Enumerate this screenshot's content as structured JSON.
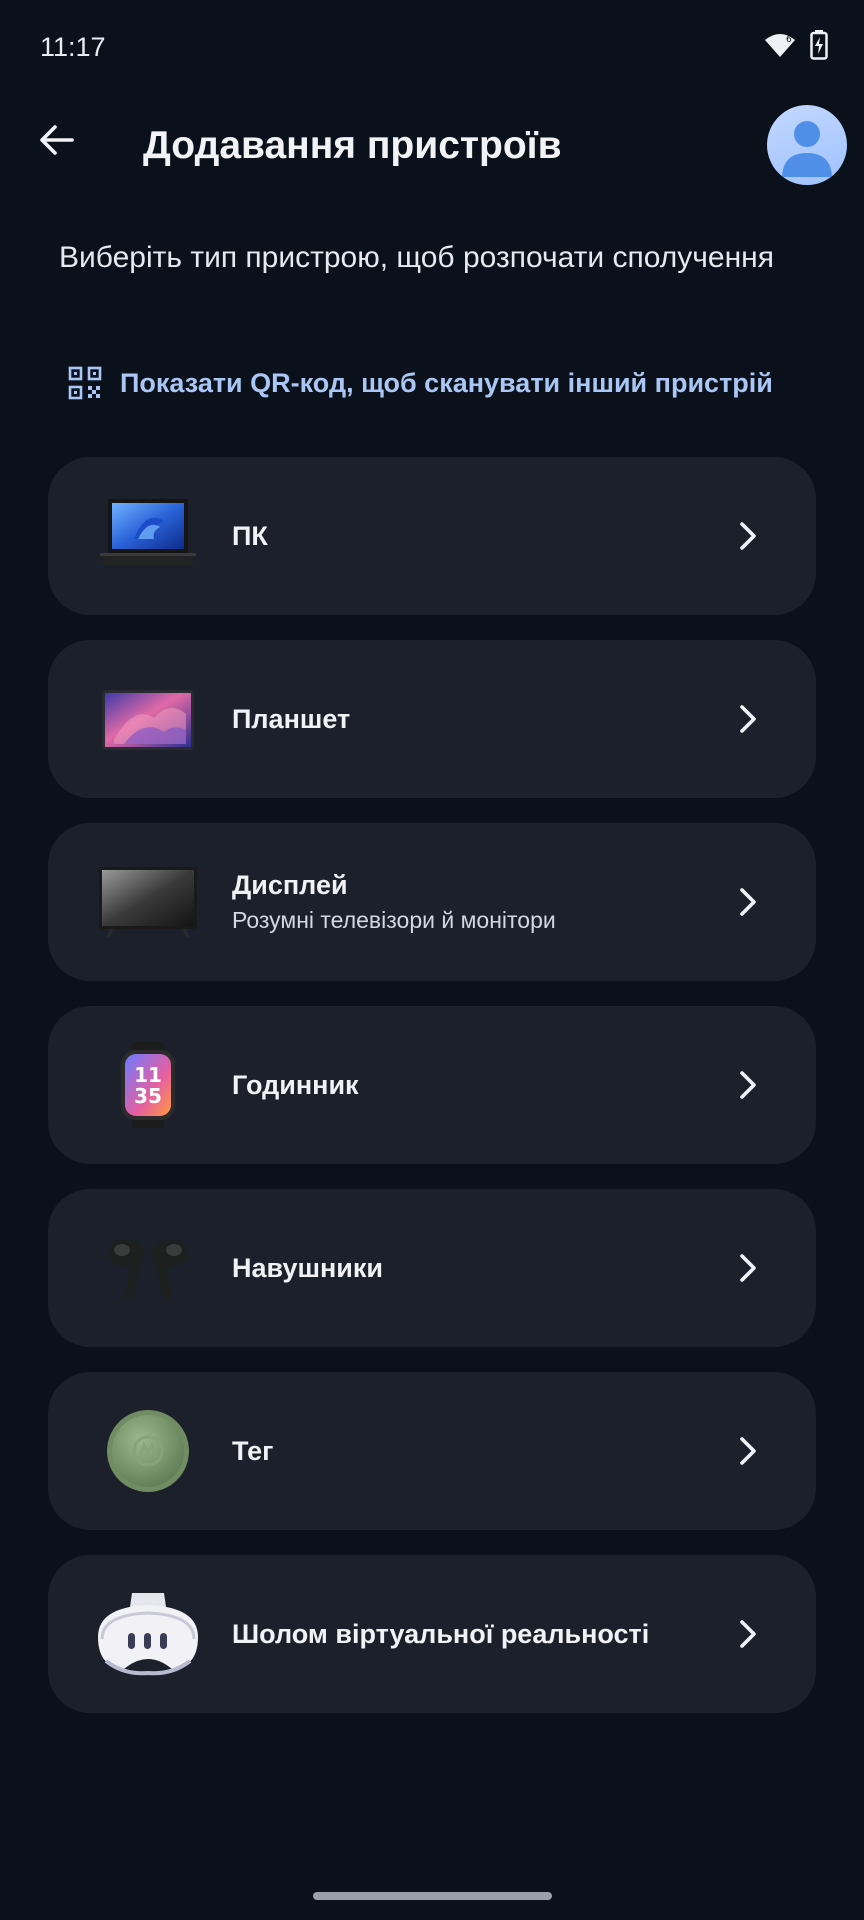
{
  "status_bar": {
    "time": "11:17",
    "wifi_icon": "wifi-icon",
    "battery_icon": "battery-charging-icon"
  },
  "header": {
    "title": "Додавання пристроїв",
    "back_icon": "arrow-left-icon",
    "avatar_icon": "account-avatar-icon"
  },
  "intro": "Виберіть тип пристрою, щоб розпочати сполучення",
  "qr_link": {
    "label": "Показати QR-код, щоб сканувати інший пристрій",
    "icon": "qr-code-icon"
  },
  "devices": [
    {
      "name": "ПК",
      "subtitle": "",
      "icon": "laptop-icon"
    },
    {
      "name": "Планшет",
      "subtitle": "",
      "icon": "tablet-icon"
    },
    {
      "name": "Дисплей",
      "subtitle": "Розумні телевізори й монітори",
      "icon": "tv-icon"
    },
    {
      "name": "Годинник",
      "subtitle": "",
      "icon": "watch-icon",
      "watch_face": [
        "11",
        "35"
      ]
    },
    {
      "name": "Навушники",
      "subtitle": "",
      "icon": "earbuds-icon"
    },
    {
      "name": "Тег",
      "subtitle": "",
      "icon": "tag-icon"
    },
    {
      "name": "Шолом віртуальної реальності",
      "subtitle": "",
      "icon": "vr-headset-icon"
    }
  ],
  "colors": {
    "background": "#0b111a",
    "card": "#1b202b",
    "accent": "#a9c6f5"
  }
}
